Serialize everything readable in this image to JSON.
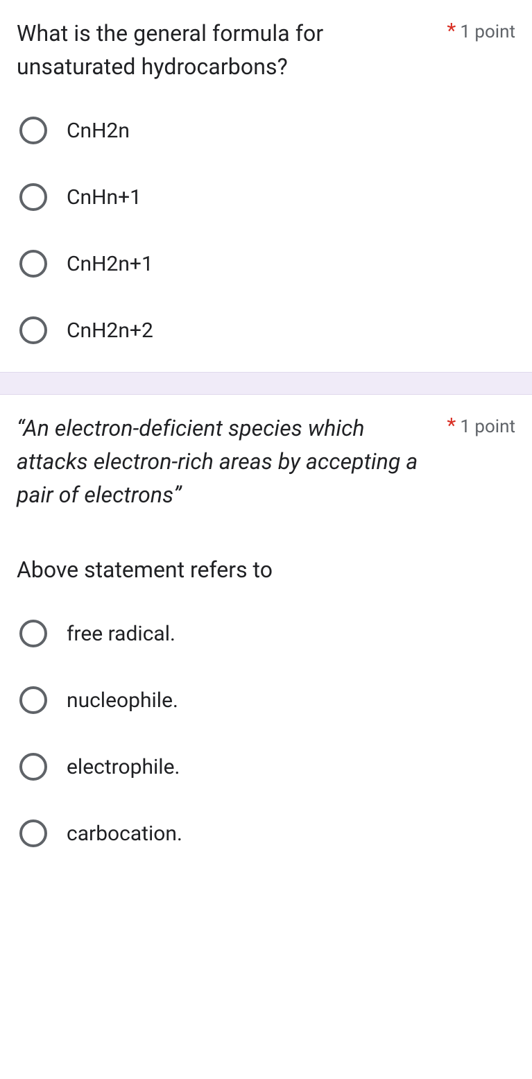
{
  "questions": [
    {
      "text": "What is the general formula for unsaturated hydrocarbons?",
      "italic": false,
      "required": "*",
      "points": "1 point",
      "subtext": "",
      "options": [
        "CnH2n",
        "CnHn+1",
        "CnH2n+1",
        "CnH2n+2"
      ]
    },
    {
      "text": "“An electron-deficient species which attacks electron-rich areas by accepting a pair of electrons”",
      "italic": true,
      "required": "*",
      "points": "1 point",
      "subtext": "Above statement refers to",
      "options": [
        "free radical.",
        "nucleophile.",
        "electrophile.",
        "carbocation."
      ]
    }
  ]
}
